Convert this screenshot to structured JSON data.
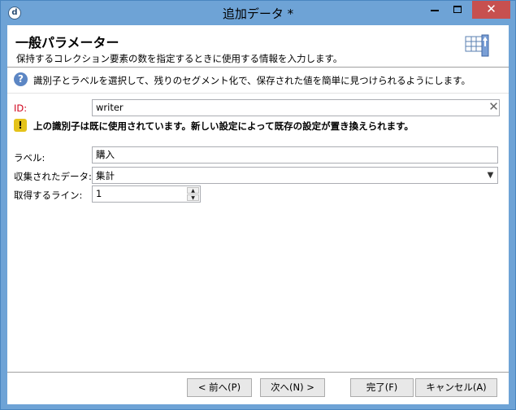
{
  "window": {
    "title": "追加データ *"
  },
  "header": {
    "title": "一般パラメーター",
    "description": "保持するコレクション要素の数を指定するときに使用する情報を入力します。"
  },
  "info": {
    "text": "識別子とラベルを選択して、残りのセグメント化で、保存された値を簡単に見つけられるようにします。"
  },
  "form": {
    "id_label": "ID:",
    "id_value": "writer",
    "warning": "上の識別子は既に使用されています。新しい設定によって既存の設定が置き換えられます。",
    "label_label": "ラベル:",
    "label_value": "購入",
    "collected_label": "収集されたデータ:",
    "collected_value": "集計",
    "lines_label": "取得するライン:",
    "lines_value": "1"
  },
  "buttons": {
    "back": "< 前へ(P)",
    "next": "次へ(N) >",
    "finish": "完了(F)",
    "cancel": "キャンセル(A)"
  },
  "colors": {
    "frame": "#6ea3d6",
    "close_button": "#c7504f",
    "error_label": "#d0021b",
    "info_icon": "#5c86c4",
    "warning_icon": "#e5c31a"
  }
}
